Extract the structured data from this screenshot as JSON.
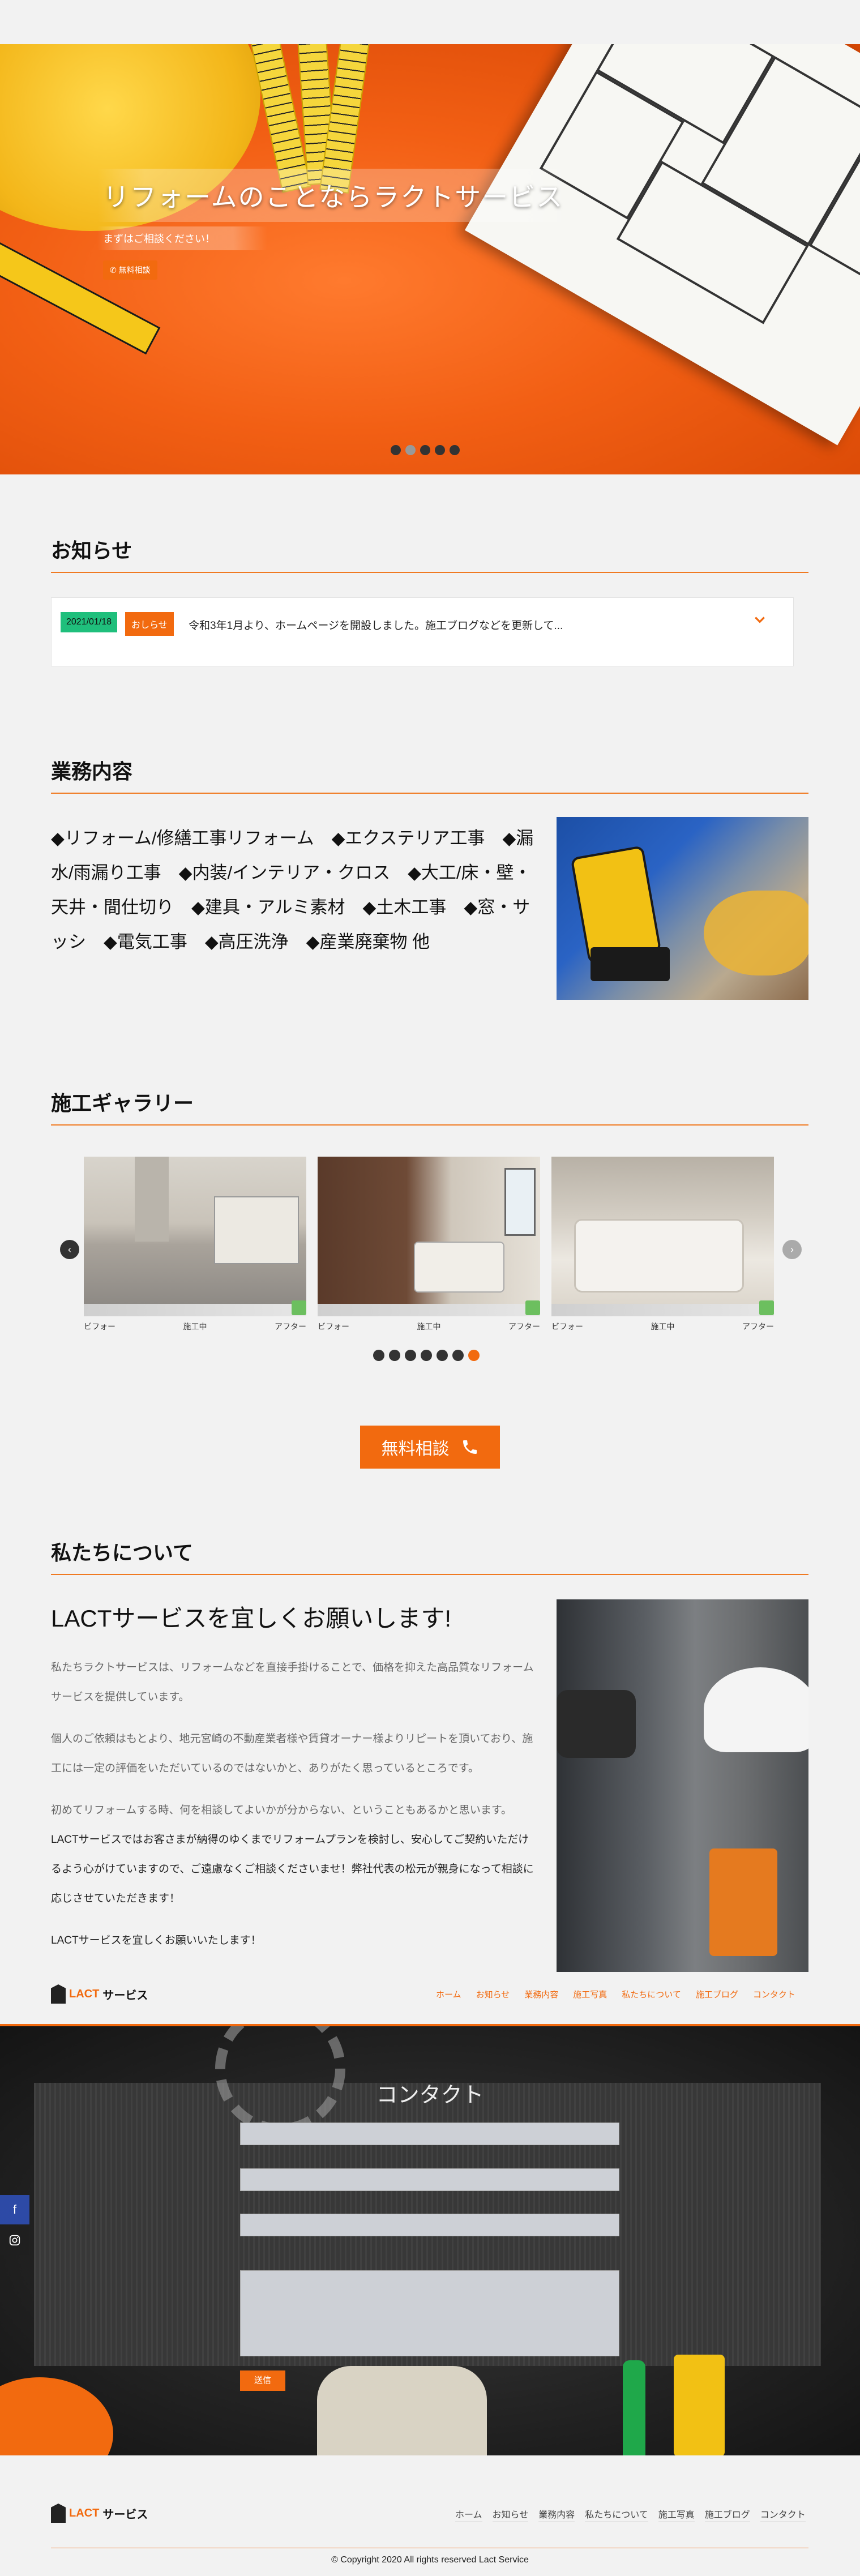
{
  "hero": {
    "title": "リフォームのことならラクトサービス",
    "subtitle": "まずはご相談ください！",
    "button_label": "無料相談",
    "slide_count": 5,
    "active_slide": 1
  },
  "news": {
    "heading": "お知らせ",
    "items": [
      {
        "date": "2021/01/18",
        "tag": "おしらせ",
        "text": "令和3年1月より、ホームページを開設しました。施工ブログなどを更新して..."
      }
    ]
  },
  "services": {
    "heading": "業務内容",
    "text": "◆リフォーム/修繕工事リフォーム　◆エクステリア工事　◆漏水/雨漏り工事　◆内装/インテリア・クロス　◆大工/床・壁・天井・間仕切り　◆建具・アルミ素材　◆土木工事　◆窓・サッシ　◆電気工事　◆高圧洗浄　◆産業廃棄物 他"
  },
  "gallery": {
    "heading": "施工ギャラリー",
    "cards": [
      {
        "before": "ビフォー",
        "during": "施工中",
        "after": "アフター"
      },
      {
        "before": "ビフォー",
        "during": "施工中",
        "after": "アフター"
      },
      {
        "before": "ビフォー",
        "during": "施工中",
        "after": "アフター"
      }
    ],
    "slide_count": 7,
    "active_slide": 7
  },
  "cta": {
    "label": "無料相談"
  },
  "about": {
    "heading": "私たちについて",
    "lead": "LACTサービスを宜しくお願いします!",
    "paragraphs": [
      "私たちラクトサービスは、リフォームなどを直接手掛けることで、価格を抑えた高品質なリフォームサービスを提供しています。",
      "個人のご依頼はもとより、地元宮崎の不動産業者様や賃貸オーナー様よりリピートを頂いており、施工には一定の評価をいただいているのではないかと、ありがたく思っているところです。",
      "初めてリフォームする時、何を相談してよいかが分からない、ということもあるかと思います。",
      "LACTサービスではお客さまが納得のゆくまでリフォームプランを検討し、安心してご契約いただけるよう心がけていますので、ご遠慮なくご相談くださいませ！弊社代表の松元が親身になって相談に応じさせていただきます！",
      "LACTサービスを宜しくお願いいたします！"
    ]
  },
  "brand": {
    "name_accent": "LACT",
    "name_rest": "サービス"
  },
  "nav": [
    "ホーム",
    "お知らせ",
    "業務内容",
    "施工写真",
    "私たちについて",
    "施工ブログ",
    "コンタクト"
  ],
  "footer_nav": [
    "ホーム",
    "お知らせ",
    "業務内容",
    "私たちについて",
    "施工写真",
    "施工ブログ",
    "コンタクト"
  ],
  "contact": {
    "heading": "コンタクト",
    "send_label": "送信"
  },
  "copyright": "© Copyright 2020 All rights reserved Lact Service",
  "colors": {
    "accent": "#f26a0f",
    "date_badge": "#1fbf7c",
    "facebook": "#2d4aa6"
  },
  "icons": {
    "phone": "phone-icon",
    "chevron": "chevron-down-icon",
    "facebook": "facebook-icon",
    "instagram": "instagram-icon"
  }
}
